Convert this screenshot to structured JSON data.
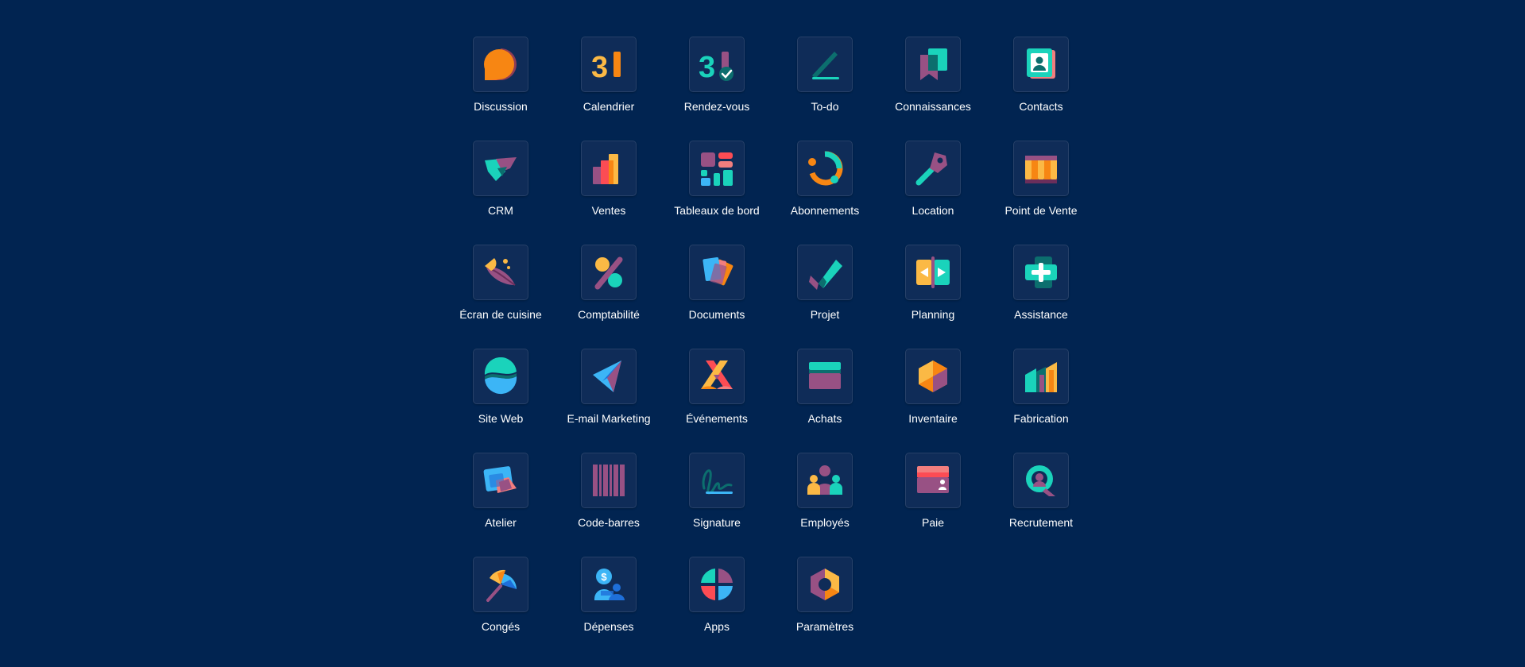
{
  "apps": [
    {
      "label": "Discussion",
      "icon": "chat-bubble-icon"
    },
    {
      "label": "Calendrier",
      "icon": "calendar-icon"
    },
    {
      "label": "Rendez-vous",
      "icon": "appointment-calendar-icon"
    },
    {
      "label": "To-do",
      "icon": "pencil-icon"
    },
    {
      "label": "Connaissances",
      "icon": "bookmark-icon"
    },
    {
      "label": "Contacts",
      "icon": "contact-card-icon"
    },
    {
      "label": "CRM",
      "icon": "handshake-icon"
    },
    {
      "label": "Ventes",
      "icon": "bar-chart-icon"
    },
    {
      "label": "Tableaux de bord",
      "icon": "dashboard-icon"
    },
    {
      "label": "Abonnements",
      "icon": "recurring-circle-icon"
    },
    {
      "label": "Location",
      "icon": "key-icon"
    },
    {
      "label": "Point de Vente",
      "icon": "storefront-icon"
    },
    {
      "label": "Écran de cuisine",
      "icon": "kitchen-whisk-icon"
    },
    {
      "label": "Comptabilité",
      "icon": "percent-icon"
    },
    {
      "label": "Documents",
      "icon": "documents-stack-icon"
    },
    {
      "label": "Projet",
      "icon": "checkmark-icon"
    },
    {
      "label": "Planning",
      "icon": "planning-arrows-icon"
    },
    {
      "label": "Assistance",
      "icon": "plus-cross-icon"
    },
    {
      "label": "Site Web",
      "icon": "globe-waves-icon"
    },
    {
      "label": "E-mail Marketing",
      "icon": "paper-plane-icon"
    },
    {
      "label": "Événements",
      "icon": "event-ribbon-icon"
    },
    {
      "label": "Achats",
      "icon": "credit-card-icon"
    },
    {
      "label": "Inventaire",
      "icon": "box-cube-icon"
    },
    {
      "label": "Fabrication",
      "icon": "factory-icon"
    },
    {
      "label": "Atelier",
      "icon": "workshop-cards-icon"
    },
    {
      "label": "Code-barres",
      "icon": "barcode-icon"
    },
    {
      "label": "Signature",
      "icon": "signature-icon"
    },
    {
      "label": "Employés",
      "icon": "people-icon"
    },
    {
      "label": "Paie",
      "icon": "payslip-card-icon"
    },
    {
      "label": "Recrutement",
      "icon": "magnifier-person-icon"
    },
    {
      "label": "Congés",
      "icon": "umbrella-icon"
    },
    {
      "label": "Dépenses",
      "icon": "expense-person-icon"
    },
    {
      "label": "Apps",
      "icon": "apps-quadrants-icon"
    },
    {
      "label": "Paramètres",
      "icon": "settings-hexagon-icon"
    }
  ],
  "colors": {
    "background": "#012451",
    "tile": "#0f2c58",
    "orange": "#F78613",
    "yellow": "#FBB945",
    "teal": "#1AD3BB",
    "purple": "#985184",
    "blue": "#3CB5F6",
    "red": "#FC4C54"
  }
}
